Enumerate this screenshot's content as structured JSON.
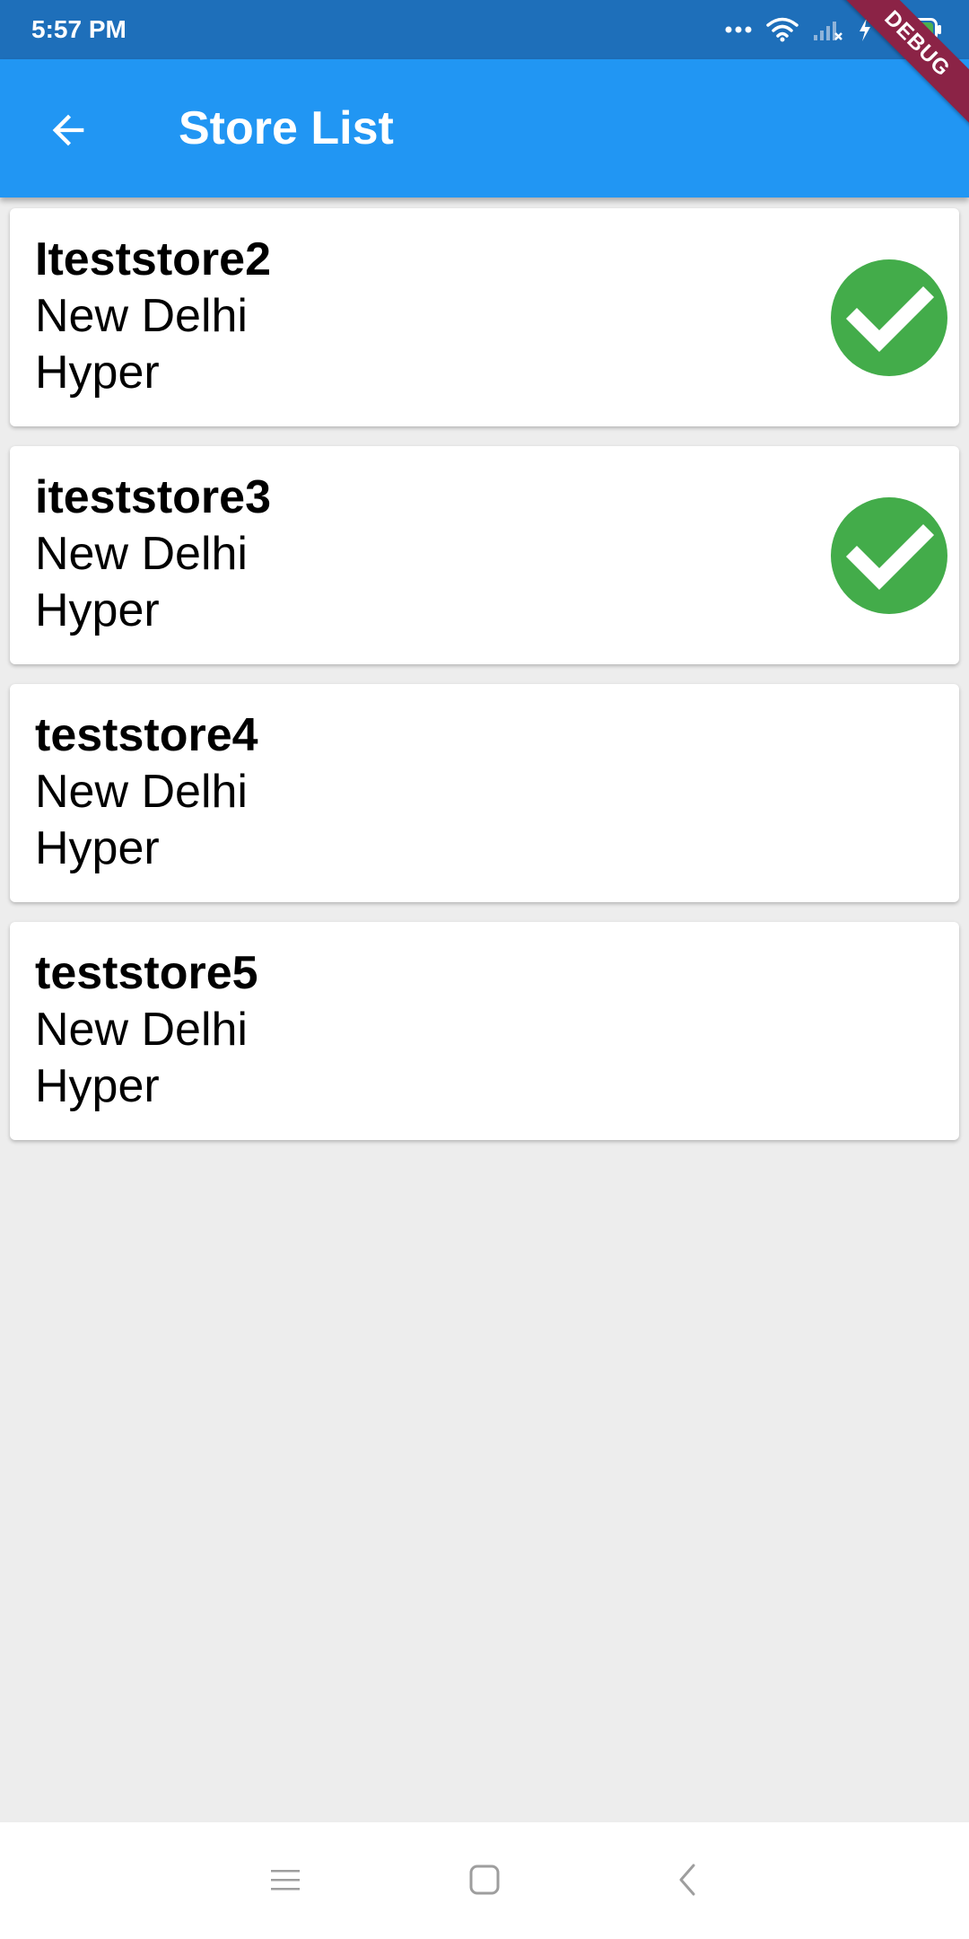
{
  "status_bar": {
    "time": "5:57 PM",
    "background_color": "#1e6fba",
    "icons": [
      "more-dots-icon",
      "wifi-icon",
      "signal-icon",
      "charging-icon",
      "battery-icon"
    ],
    "battery_color": "#4caf50"
  },
  "debug_banner": {
    "label": "DEBUG",
    "color": "#8b2346"
  },
  "app_bar": {
    "title": "Store List",
    "back_icon": "arrow-back-icon",
    "background_color": "#2196f3"
  },
  "stores": [
    {
      "name": "Iteststore2",
      "city": "New Delhi",
      "type": "Hyper",
      "selected": true
    },
    {
      "name": "iteststore3",
      "city": "New Delhi",
      "type": "Hyper",
      "selected": true
    },
    {
      "name": "teststore4",
      "city": "New Delhi",
      "type": "Hyper",
      "selected": false
    },
    {
      "name": "teststore5",
      "city": "New Delhi",
      "type": "Hyper",
      "selected": false
    }
  ],
  "selected_icon": {
    "name": "check-circle-icon",
    "color": "#43ac4a"
  },
  "nav_bar": {
    "icons": [
      "menu-icon",
      "home-square-icon",
      "back-chevron-icon"
    ]
  }
}
